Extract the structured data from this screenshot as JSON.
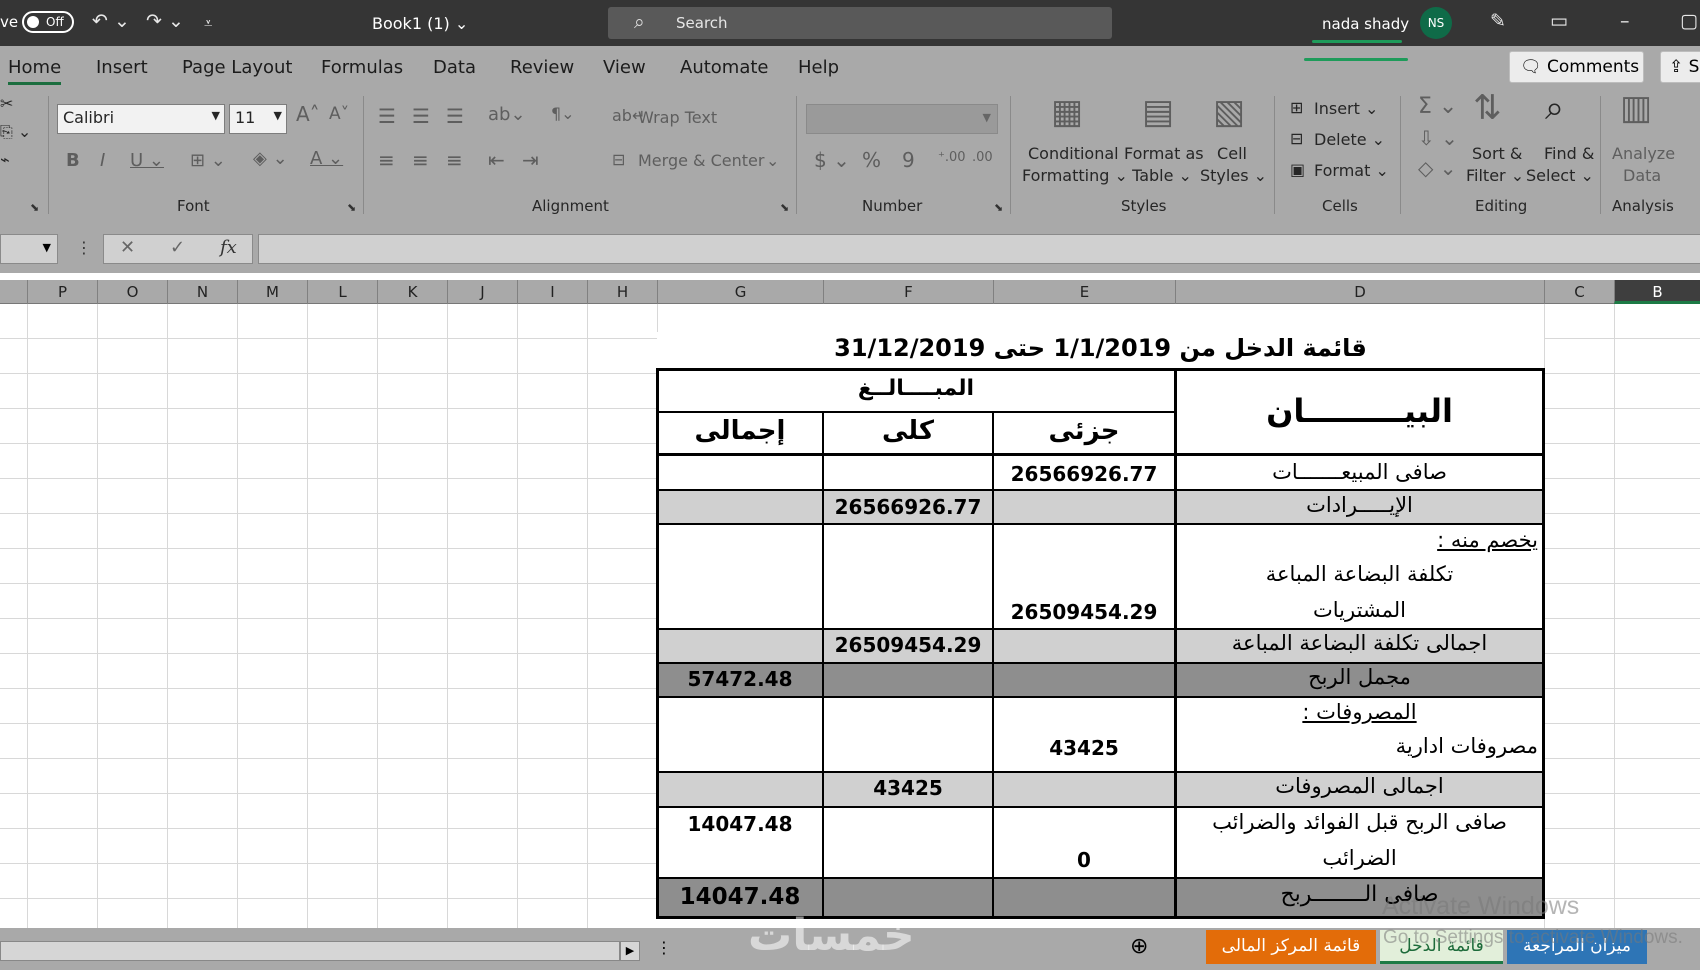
{
  "titlebar": {
    "autosave_label": "ve",
    "autosave_state": "Off",
    "doc_title": "Book1 (1) ⌄",
    "search_placeholder": "Search",
    "user_name": "nada shady",
    "user_initials": "NS"
  },
  "ribbon_tabs": [
    "Home",
    "Insert",
    "Page Layout",
    "Formulas",
    "Data",
    "Review",
    "View",
    "Automate",
    "Help"
  ],
  "comments_label": "Comments",
  "share_label": "S",
  "ribbon": {
    "font_name": "Calibri",
    "font_size": "11",
    "wrap_text": "Wrap Text",
    "merge_center": "Merge & Center",
    "conditional_formatting": [
      "Conditional",
      "Formatting ⌄"
    ],
    "format_as_table": [
      "Format as",
      "Table ⌄"
    ],
    "cell_styles": [
      "Cell",
      "Styles ⌄"
    ],
    "insert": "Insert ⌄",
    "delete": "Delete ⌄",
    "format": "Format ⌄",
    "sort_filter": [
      "Sort &",
      "Filter ⌄"
    ],
    "find_select": [
      "Find &",
      "Select ⌄"
    ],
    "analyze_data": [
      "Analyze",
      "Data"
    ],
    "groups": {
      "font": "Font",
      "alignment": "Alignment",
      "number": "Number",
      "styles": "Styles",
      "cells": "Cells",
      "editing": "Editing",
      "analysis": "Analysis"
    }
  },
  "columns": [
    "P",
    "O",
    "N",
    "M",
    "L",
    "K",
    "J",
    "I",
    "H",
    "G",
    "F",
    "E",
    "D",
    "C",
    "B"
  ],
  "selected_column": "B",
  "sheet": {
    "title": "قائمة الدخل من 1/1/2019 حتى 31/12/2019",
    "header_desc": "البيـــــــــان",
    "header_amounts": "المبــــالــغ",
    "header_partial": "جزئى",
    "header_total": "كلى",
    "header_grand": "إجمالى",
    "rows": [
      {
        "label": "صافى المبيعـــــــات",
        "partial": "26566926.77",
        "total": "",
        "grand": ""
      },
      {
        "label": "الإيـــــرادات",
        "partial": "",
        "total": "26566926.77",
        "grand": ""
      },
      {
        "label": "يخصم منه :",
        "partial": "",
        "total": "",
        "grand": ""
      },
      {
        "label": "تكلفة البضاعة المباعة",
        "partial": "",
        "total": "",
        "grand": ""
      },
      {
        "label": "المشتريات",
        "partial": "26509454.29",
        "total": "",
        "grand": ""
      },
      {
        "label": "اجمالى تكلفة البضاعة المباعة",
        "partial": "",
        "total": "26509454.29",
        "grand": ""
      },
      {
        "label": "مجمل الربح",
        "partial": "",
        "total": "",
        "grand": "57472.48"
      },
      {
        "label": "المصروفات :",
        "partial": "",
        "total": "",
        "grand": ""
      },
      {
        "label": "مصروفات ادارية",
        "partial": "43425",
        "total": "",
        "grand": ""
      },
      {
        "label": "اجمالى المصروفات",
        "partial": "",
        "total": "43425",
        "grand": ""
      },
      {
        "label": "صافى الربح قبل الفوائد والضرائب",
        "partial": "",
        "total": "",
        "grand": "14047.48"
      },
      {
        "label": "الضرائب",
        "partial": "0",
        "total": "",
        "grand": ""
      },
      {
        "label": "صافى الــــــــربح",
        "partial": "",
        "total": "",
        "grand": "14047.48"
      }
    ]
  },
  "sheet_tabs": [
    "قائمة المركز المالى",
    "قائمة الدخل",
    "ميزان المراجعة"
  ],
  "tab_colors": {
    "financial_position": "#e36c09",
    "income": "#e2efda",
    "trial_balance": "#2e75b6"
  },
  "overlay": {
    "activate_title": "Activate Windows",
    "activate_sub": "Go to Settings to activate Windows.",
    "watermark": "خمسات"
  }
}
